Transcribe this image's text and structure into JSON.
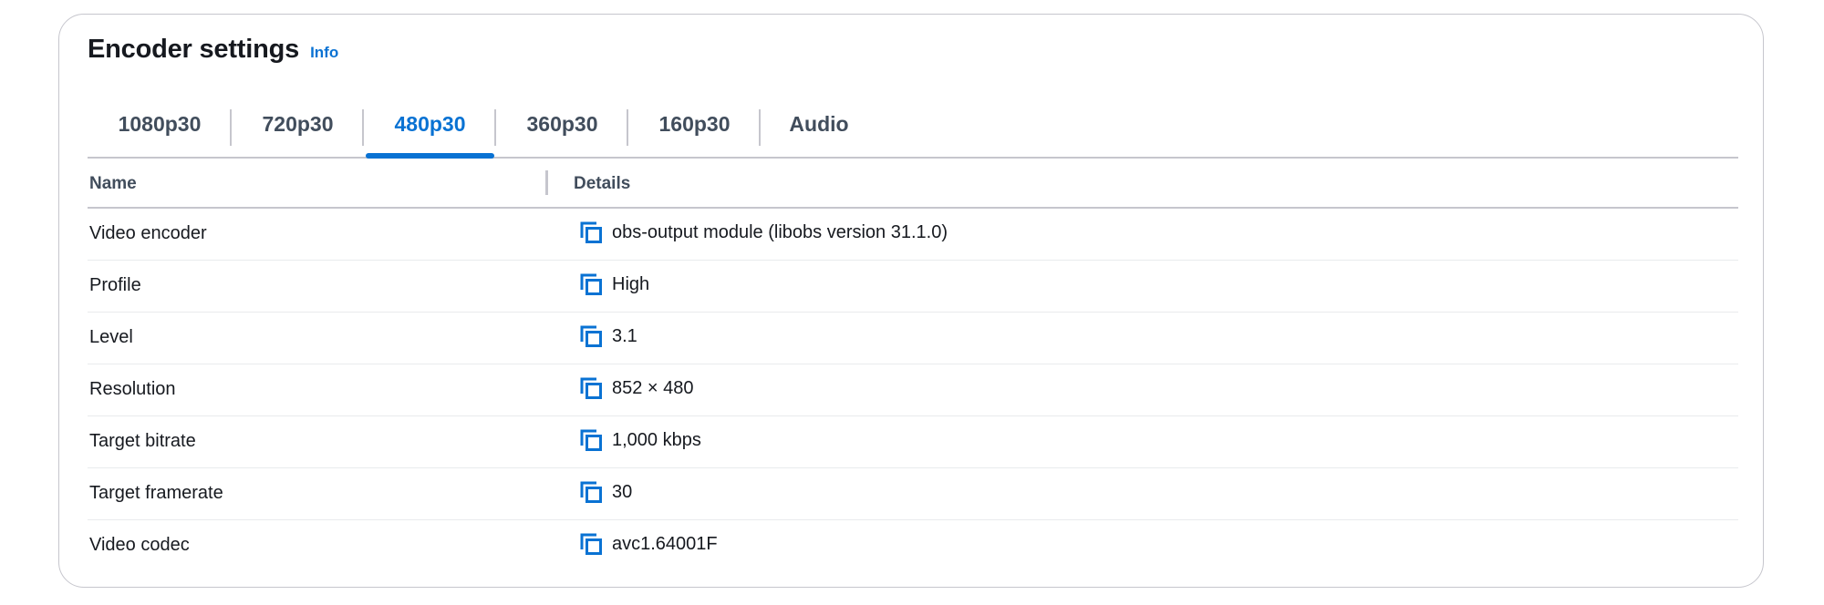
{
  "header": {
    "title": "Encoder settings",
    "info_label": "Info"
  },
  "tabs": [
    {
      "label": "1080p30",
      "active": false
    },
    {
      "label": "720p30",
      "active": false
    },
    {
      "label": "480p30",
      "active": true
    },
    {
      "label": "360p30",
      "active": false
    },
    {
      "label": "160p30",
      "active": false
    },
    {
      "label": "Audio",
      "active": false
    }
  ],
  "table": {
    "columns": [
      "Name",
      "Details"
    ],
    "rows": [
      {
        "name": "Video encoder",
        "details": "obs-output module (libobs version 31.1.0)"
      },
      {
        "name": "Profile",
        "details": "High"
      },
      {
        "name": "Level",
        "details": "3.1"
      },
      {
        "name": "Resolution",
        "details": "852 × 480"
      },
      {
        "name": "Target bitrate",
        "details": "1,000 kbps"
      },
      {
        "name": "Target framerate",
        "details": "30"
      },
      {
        "name": "Video codec",
        "details": "avc1.64001F"
      }
    ]
  },
  "colors": {
    "accent": "#0972d3",
    "text": "#16191f",
    "muted_text": "#414d5c",
    "border": "#c6c6cd",
    "row_divider": "#e9ebed"
  },
  "icons": {
    "copy": "copy-icon"
  }
}
